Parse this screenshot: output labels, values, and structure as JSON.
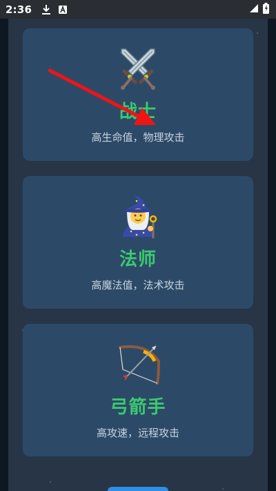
{
  "status_bar": {
    "time": "2:36",
    "icons": [
      "download-icon",
      "notification-a-icon",
      "signal-icon",
      "battery-icon"
    ]
  },
  "classes": [
    {
      "icon": "crossed-swords-icon",
      "title": "战士",
      "description": "高生命值，物理攻击"
    },
    {
      "icon": "mage-icon",
      "title": "法师",
      "description": "高魔法值，法术攻击"
    },
    {
      "icon": "bow-and-arrow-icon",
      "title": "弓箭手",
      "description": "高攻速，远程攻击"
    }
  ],
  "colors": {
    "title_green": "#3cc96f",
    "card_bg": "#2c4a68",
    "arrow_red": "#f01414",
    "button_blue": "#2f8fe8"
  }
}
